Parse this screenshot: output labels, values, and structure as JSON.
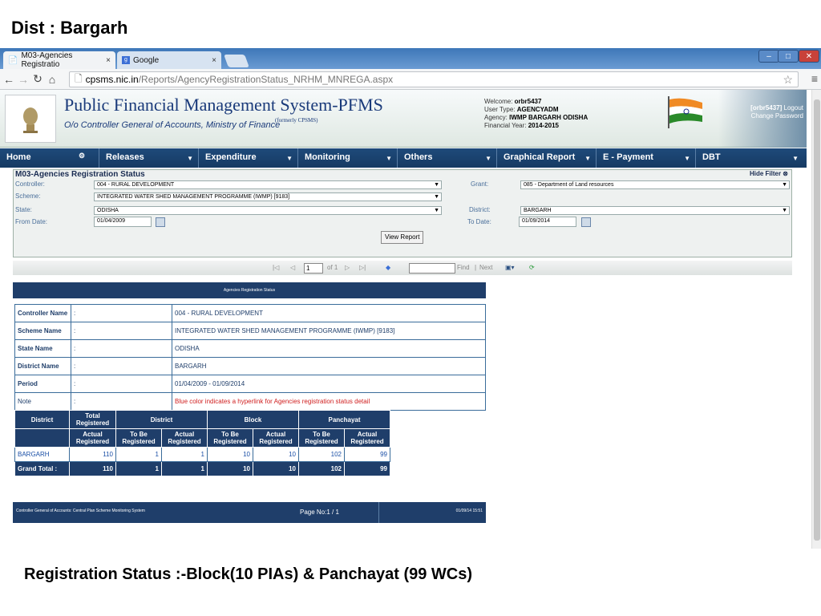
{
  "slide": {
    "title": "Dist : Bargarh",
    "caption": "Registration Status :-Block(10 PIAs) & Panchayat (99 WCs)"
  },
  "browser": {
    "tabs": [
      {
        "label": "M03-Agencies Registratio",
        "close": "×"
      },
      {
        "label": "Google",
        "close": "×"
      }
    ],
    "url_host": "cpsms.nic.in",
    "url_path": "/Reports/AgencyRegistrationStatus_NRHM_MNREGA.aspx"
  },
  "header": {
    "title": "Public Financial Management System-PFMS",
    "formerly": "(formerly CPSMS)",
    "subtitle": "O/o Controller General of Accounts, Ministry of Finance",
    "welcome_label": "Welcome:",
    "welcome_value": "orbr5437",
    "user_type_label": "User Type:",
    "user_type_value": "AGENCYADM",
    "agency_label": "Agency:",
    "agency_value": "IWMP BARGARH ODISHA",
    "fy_label": "Financial Year:",
    "fy_value": "2014-2015",
    "user_link": "[orbr5437]",
    "logout": "Logout",
    "change_password": "Change Password"
  },
  "menu": [
    "Home",
    "Releases",
    "Expenditure",
    "Monitoring",
    "Others",
    "Graphical Report",
    "E - Payment",
    "DBT"
  ],
  "filter": {
    "title": "M03-Agencies Registration Status",
    "hide": "Hide Filter",
    "controller_label": "Controller:",
    "controller_value": "004 - RURAL DEVELOPMENT",
    "scheme_label": "Scheme:",
    "scheme_value": "INTEGRATED WATER SHED MANAGEMENT PROGRAMME (IWMP) [9183]",
    "state_label": "State:",
    "state_value": "ODISHA",
    "from_label": "From Date:",
    "from_value": "01/04/2009",
    "grant_label": "Grant:",
    "grant_value": "085 - Department of Land resources",
    "district_label": "District:",
    "district_value": "BARGARH",
    "to_label": "To Date:",
    "to_value": "01/09/2014",
    "view_button": "View Report"
  },
  "toolbar": {
    "page_value": "1",
    "of_pages": "of 1",
    "find": "Find",
    "sep": "|",
    "next": "Next"
  },
  "report": {
    "header": "Agencies Registration Status",
    "info": [
      {
        "key": "Controller Name",
        "colon": ":",
        "value": "004 - RURAL DEVELOPMENT"
      },
      {
        "key": "Scheme Name",
        "colon": ":",
        "value": "INTEGRATED WATER SHED MANAGEMENT PROGRAMME (IWMP) [9183]"
      },
      {
        "key": "State  Name",
        "colon": ":",
        "value": "ODISHA"
      },
      {
        "key": "District Name",
        "colon": ":",
        "value": "BARGARH"
      },
      {
        "key": "Period",
        "colon": ":",
        "value": "01/04/2009 - 01/09/2014"
      },
      {
        "key": "Note",
        "colon": ":",
        "value": "Blue color indicates a hyperlink for Agencies registration status detail"
      }
    ],
    "table": {
      "h_district": "District",
      "h_total": "Total Registered",
      "h_district_grp": "District",
      "h_block": "Block",
      "h_panchayat": "Panchayat",
      "h_actual": "Actual Registered",
      "h_tobe": "To Be Registered",
      "rows": [
        {
          "name": "BARGARH",
          "total": "110",
          "d_tobe": "1",
          "d_actual": "1",
          "b_tobe": "10",
          "b_actual": "10",
          "p_tobe": "102",
          "p_actual": "99"
        }
      ],
      "grand_total": {
        "name": "Grand Total :",
        "total": "110",
        "d_tobe": "1",
        "d_actual": "1",
        "b_tobe": "10",
        "b_actual": "10",
        "p_tobe": "102",
        "p_actual": "99"
      }
    },
    "footer_left": "Controller General of Accounts: Central Plan Scheme Monitoring System",
    "footer_page": "Page No:1 / 1",
    "footer_date": "01/09/14 15:51"
  }
}
